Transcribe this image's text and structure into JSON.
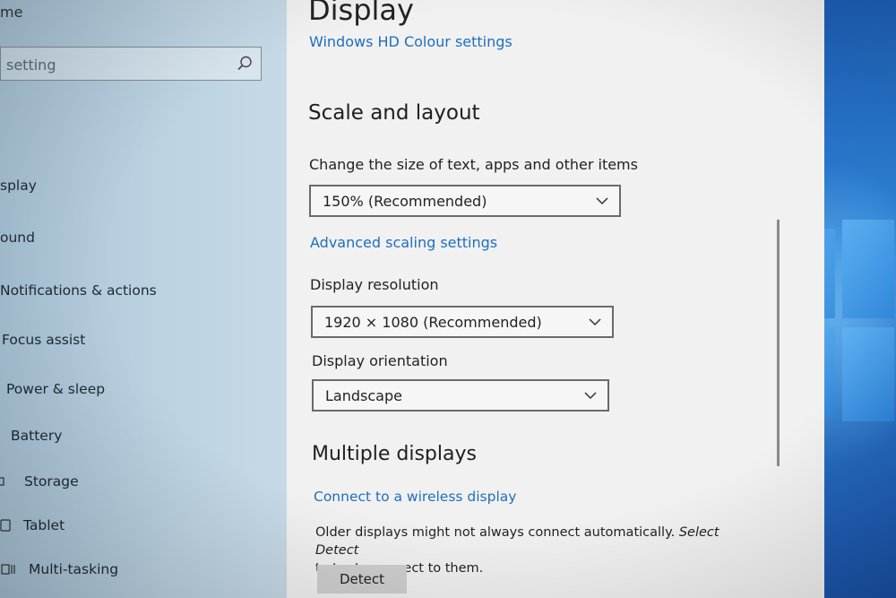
{
  "sidebar": {
    "home_label": "me",
    "search": {
      "placeholder": "setting"
    },
    "items": [
      {
        "label": "splay"
      },
      {
        "label": "ound"
      },
      {
        "label": "Notifications & actions"
      },
      {
        "label": "Focus assist"
      },
      {
        "label": "Power & sleep"
      },
      {
        "label": "Battery"
      },
      {
        "label": "Storage"
      },
      {
        "label": "Tablet"
      },
      {
        "label": "Multi-tasking"
      }
    ]
  },
  "main": {
    "title": "Display",
    "hd_colour_link": "Windows HD Colour settings",
    "scale_layout": {
      "heading": "Scale and layout",
      "size_label": "Change the size of text, apps and other items",
      "size_value": "150% (Recommended)",
      "advanced_link": "Advanced scaling settings",
      "resolution_label": "Display resolution",
      "resolution_value": "1920 × 1080 (Recommended)",
      "orientation_label": "Display orientation",
      "orientation_value": "Landscape"
    },
    "multiple_displays": {
      "heading": "Multiple displays",
      "wireless_link": "Connect to a wireless display",
      "info_text_1": "Older displays might not always connect automatically. ",
      "info_text_em": "Select Detect",
      "info_text_2": "to try to connect to them.",
      "detect_label": "Detect"
    }
  },
  "colors": {
    "link": "#1e6fbd",
    "sidebar_bg": "#bdd3e2",
    "content_bg": "#f1f1f1"
  }
}
